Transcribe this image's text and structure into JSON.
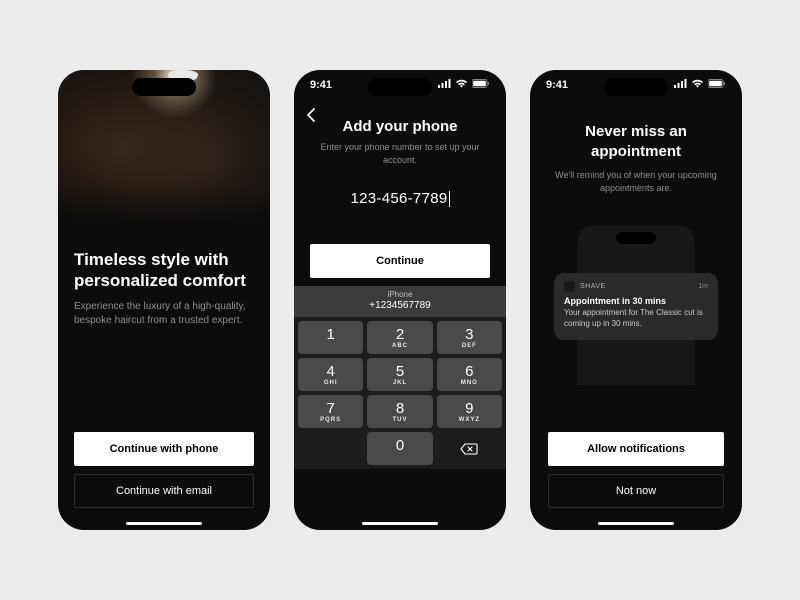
{
  "status": {
    "time": "9:41"
  },
  "screen1": {
    "title": "Timeless style with personalized comfort",
    "subtitle": "Experience the luxury of a high-quality, bespoke haircut from a trusted expert.",
    "cta_phone": "Continue with phone",
    "cta_email": "Continue with email"
  },
  "screen2": {
    "title": "Add your phone",
    "subtitle": "Enter your phone number to set up your account.",
    "input_value": "123-456-7789",
    "continue_label": "Continue",
    "suggestion_label": "iPhone",
    "suggestion_number": "+1234567789",
    "keys": [
      {
        "n": "1",
        "l": ""
      },
      {
        "n": "2",
        "l": "ABC"
      },
      {
        "n": "3",
        "l": "DEF"
      },
      {
        "n": "4",
        "l": "GHI"
      },
      {
        "n": "5",
        "l": "JKL"
      },
      {
        "n": "6",
        "l": "MNO"
      },
      {
        "n": "7",
        "l": "PQRS"
      },
      {
        "n": "8",
        "l": "TUV"
      },
      {
        "n": "9",
        "l": "WXYZ"
      },
      {
        "n": "0",
        "l": ""
      }
    ]
  },
  "screen3": {
    "title": "Never miss an appointment",
    "subtitle": "We'll remind you of when your upcoming appointments are.",
    "notif_app": "SHAVE",
    "notif_time": "1m",
    "notif_title": "Appointment in 30 mins",
    "notif_body": "Your appointment for The Classic cut is coming up in 30 mins.",
    "allow_label": "Allow notifications",
    "notnow_label": "Not now"
  }
}
